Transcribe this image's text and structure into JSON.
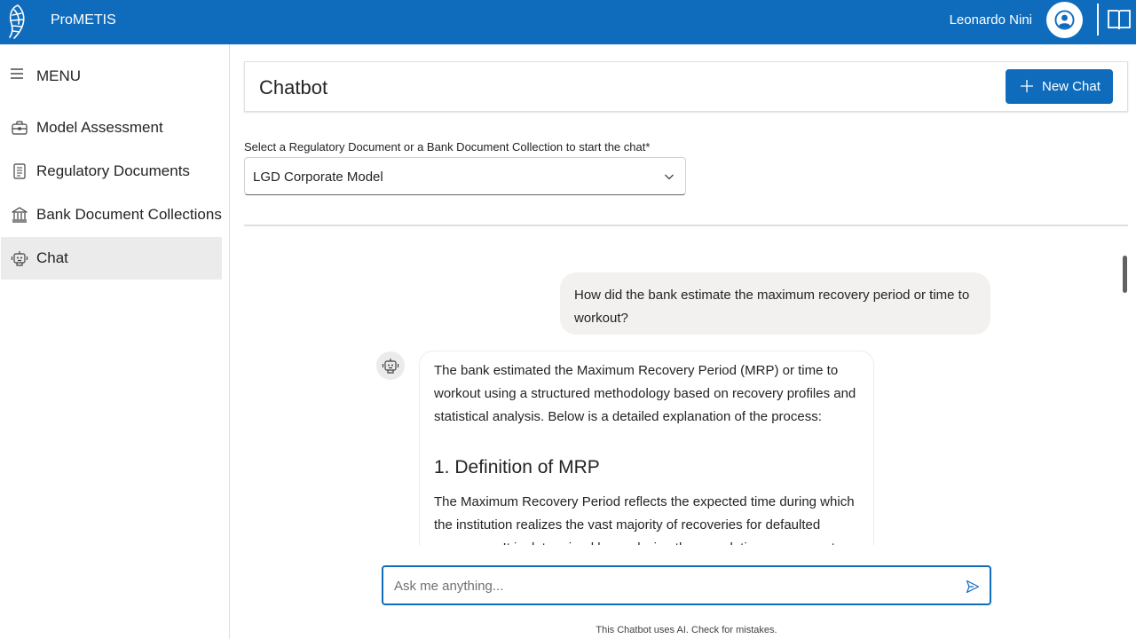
{
  "header": {
    "app_title": "ProMETIS",
    "user_name": "Leonardo Nini"
  },
  "sidebar": {
    "menu_label": "MENU",
    "items": [
      {
        "label": "Model Assessment",
        "icon": "briefcase-icon"
      },
      {
        "label": "Regulatory Documents",
        "icon": "document-icon"
      },
      {
        "label": "Bank Document Collections",
        "icon": "bank-icon"
      },
      {
        "label": "Chat",
        "icon": "bot-icon",
        "active": true
      }
    ]
  },
  "main": {
    "page_title": "Chatbot",
    "new_chat_label": "New Chat",
    "select_label": "Select a Regulatory Document or a Bank Document Collection to start the chat*",
    "selected_value": "LGD Corporate Model"
  },
  "chat": {
    "messages": [
      {
        "role": "user",
        "text": "How did the bank estimate the maximum recovery period or time to workout?"
      },
      {
        "role": "bot",
        "intro": "The bank estimated the Maximum Recovery Period (MRP) or time to workout using a structured methodology based on recovery profiles and statistical analysis. Below is a detailed explanation of the process:",
        "heading": "1. Definition of MRP",
        "body": "The Maximum Recovery Period reflects the expected time during which the institution realizes the vast majority of recoveries for defaulted exposures. It is determined by analyzing the cumulative recovery rate curves and"
      }
    ],
    "input_placeholder": "Ask me anything...",
    "disclaimer": "This Chatbot uses AI. Check for mistakes."
  },
  "colors": {
    "brand": "#0f6cbd",
    "active_nav": "#ebebeb",
    "user_bubble": "#f2f1ef"
  }
}
